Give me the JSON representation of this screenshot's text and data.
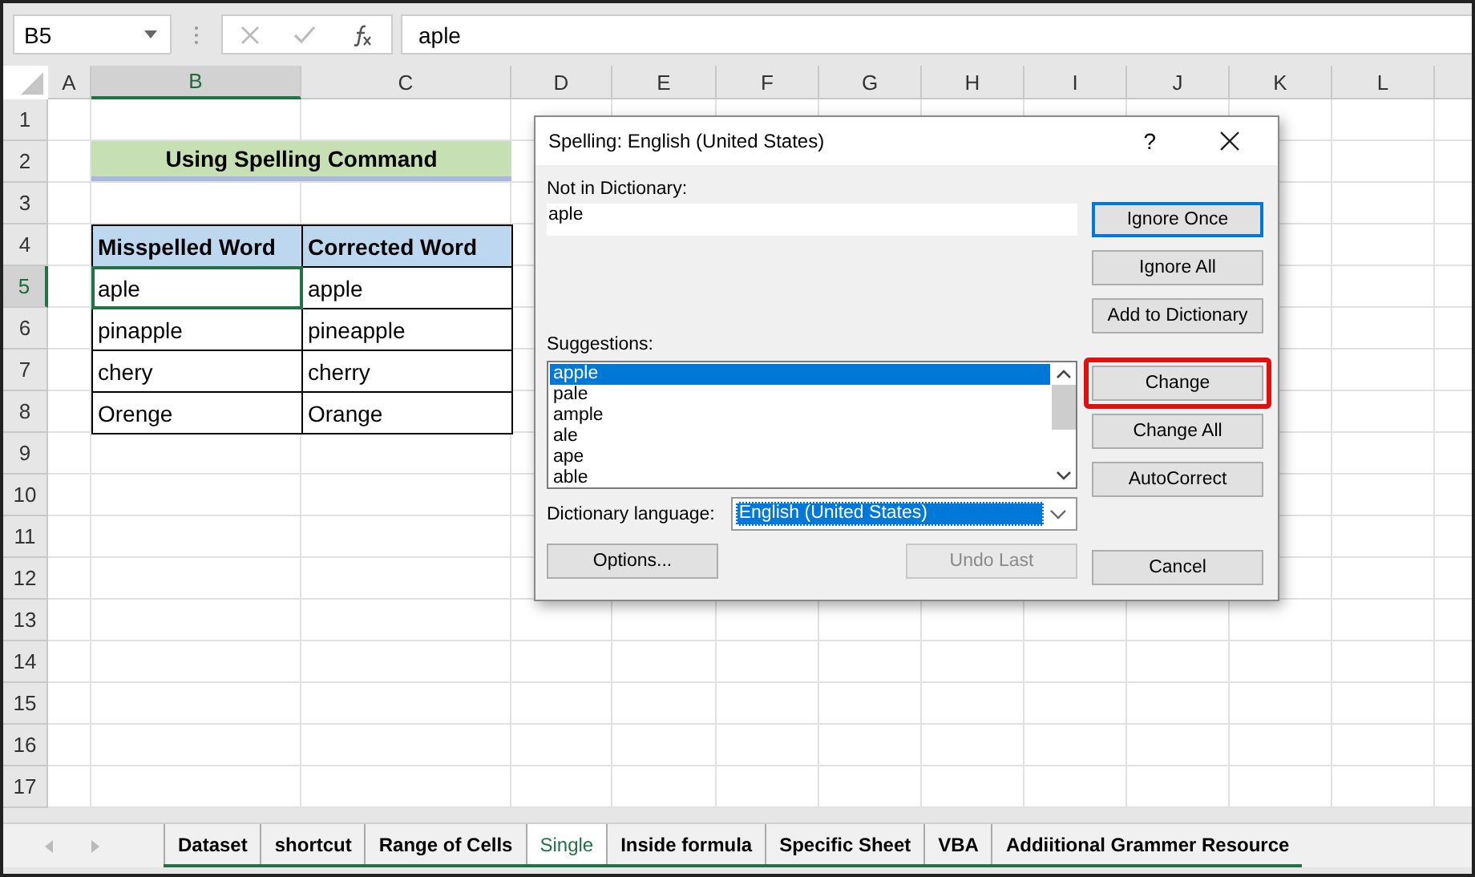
{
  "name_box": "B5",
  "formula_bar": {
    "value": "aple"
  },
  "columns": [
    {
      "label": "A",
      "selected": false
    },
    {
      "label": "B",
      "selected": true
    },
    {
      "label": "C",
      "selected": false
    },
    {
      "label": "D",
      "selected": false
    },
    {
      "label": "E",
      "selected": false
    },
    {
      "label": "F",
      "selected": false
    },
    {
      "label": "G",
      "selected": false
    },
    {
      "label": "H",
      "selected": false
    },
    {
      "label": "I",
      "selected": false
    },
    {
      "label": "J",
      "selected": false
    },
    {
      "label": "K",
      "selected": false
    },
    {
      "label": "L",
      "selected": false
    }
  ],
  "rows": [
    {
      "label": "1",
      "selected": false
    },
    {
      "label": "2",
      "selected": false
    },
    {
      "label": "3",
      "selected": false
    },
    {
      "label": "4",
      "selected": false
    },
    {
      "label": "5",
      "selected": true
    },
    {
      "label": "6",
      "selected": false
    },
    {
      "label": "7",
      "selected": false
    },
    {
      "label": "8",
      "selected": false
    },
    {
      "label": "9",
      "selected": false
    },
    {
      "label": "10",
      "selected": false
    },
    {
      "label": "11",
      "selected": false
    },
    {
      "label": "12",
      "selected": false
    },
    {
      "label": "13",
      "selected": false
    },
    {
      "label": "14",
      "selected": false
    },
    {
      "label": "15",
      "selected": false
    },
    {
      "label": "16",
      "selected": false
    },
    {
      "label": "17",
      "selected": false
    }
  ],
  "sheet": {
    "title": "Using Spelling Command",
    "table": {
      "columns": [
        "Misspelled Word",
        "Corrected Word"
      ],
      "rows": [
        {
          "cells": [
            {
              "text": "aple",
              "selected": true
            },
            {
              "text": "apple",
              "selected": false
            }
          ]
        },
        {
          "cells": [
            {
              "text": "pinapple",
              "selected": false
            },
            {
              "text": "pineapple",
              "selected": false
            }
          ]
        },
        {
          "cells": [
            {
              "text": "chery",
              "selected": false
            },
            {
              "text": "cherry",
              "selected": false
            }
          ]
        },
        {
          "cells": [
            {
              "text": "Orenge",
              "selected": false
            },
            {
              "text": "Orange",
              "selected": false
            }
          ]
        }
      ]
    }
  },
  "dialog": {
    "title": "Spelling: English (United States)",
    "help": "?",
    "not_in_dictionary": {
      "label": "Not in Dictionary:",
      "value": "aple"
    },
    "suggestions": {
      "label": "Suggestions:",
      "items": [
        {
          "text": "apple",
          "selected": true
        },
        {
          "text": "pale",
          "selected": false
        },
        {
          "text": "ample",
          "selected": false
        },
        {
          "text": "ale",
          "selected": false
        },
        {
          "text": "ape",
          "selected": false
        },
        {
          "text": "able",
          "selected": false
        }
      ]
    },
    "dictionary_language": {
      "label": "Dictionary language:",
      "value": "English (United States)"
    },
    "side_buttons": [
      {
        "label": "Ignore Once",
        "kind": "default",
        "highlighted": false
      },
      {
        "label": "Ignore All",
        "kind": "normal",
        "highlighted": false
      },
      {
        "label": "Add to Dictionary",
        "kind": "normal",
        "highlighted": false
      },
      {
        "label": "Change",
        "kind": "normal",
        "highlighted": true
      },
      {
        "label": "Change All",
        "kind": "normal",
        "highlighted": false
      },
      {
        "label": "AutoCorrect",
        "kind": "normal",
        "highlighted": false
      },
      {
        "label": "Cancel",
        "kind": "normal",
        "highlighted": false
      }
    ],
    "bottom_buttons": [
      {
        "label": "Options...",
        "kind": "normal",
        "highlighted": false
      },
      {
        "label": "Undo Last",
        "kind": "disabled",
        "highlighted": false
      }
    ]
  },
  "sheet_tabs": [
    {
      "label": "Dataset",
      "selected": false
    },
    {
      "label": "shortcut",
      "selected": false
    },
    {
      "label": "Range of Cells",
      "selected": false
    },
    {
      "label": "Single",
      "selected": true
    },
    {
      "label": "Inside formula",
      "selected": false
    },
    {
      "label": "Specific Sheet",
      "selected": false
    },
    {
      "label": "VBA",
      "selected": false
    },
    {
      "label": "Addiitional Grammer Resource",
      "selected": false
    }
  ]
}
